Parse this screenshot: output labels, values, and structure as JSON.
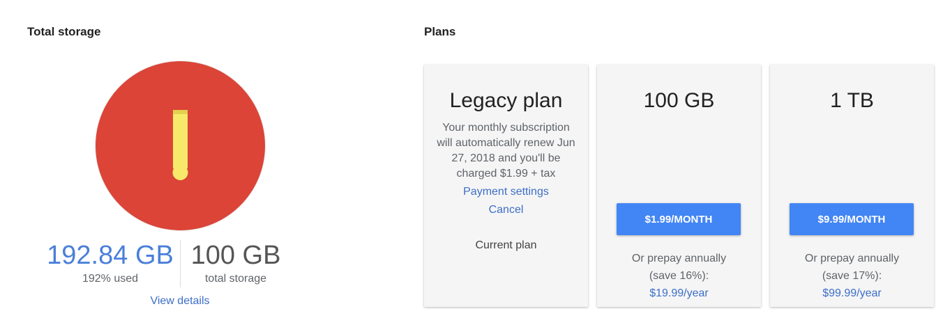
{
  "storage": {
    "title": "Total storage",
    "alert_icon": "exclamation-warning-icon",
    "alert_color": "#db4437",
    "used_value": "192.84 GB",
    "used_label": "192% used",
    "total_value": "100 GB",
    "total_label": "total storage",
    "view_details": "View details"
  },
  "plans": {
    "title": "Plans",
    "legacy": {
      "name": "Legacy plan",
      "description": "Your monthly subscription will automatically renew Jun 27, 2018 and you'll be charged $1.99 + tax",
      "payment_settings": "Payment settings",
      "cancel": "Cancel",
      "status": "Current plan"
    },
    "cards": [
      {
        "name": "100 GB",
        "button": "$1.99/MONTH",
        "prepay_line1": "Or prepay annually",
        "prepay_line2": "(save 16%):",
        "yearly_price": "$19.99/year"
      },
      {
        "name": "1 TB",
        "button": "$9.99/MONTH",
        "prepay_line1": "Or prepay annually",
        "prepay_line2": "(save 17%):",
        "yearly_price": "$99.99/year"
      }
    ],
    "button_color": "#4285f4",
    "link_color": "#3d6ec7"
  }
}
